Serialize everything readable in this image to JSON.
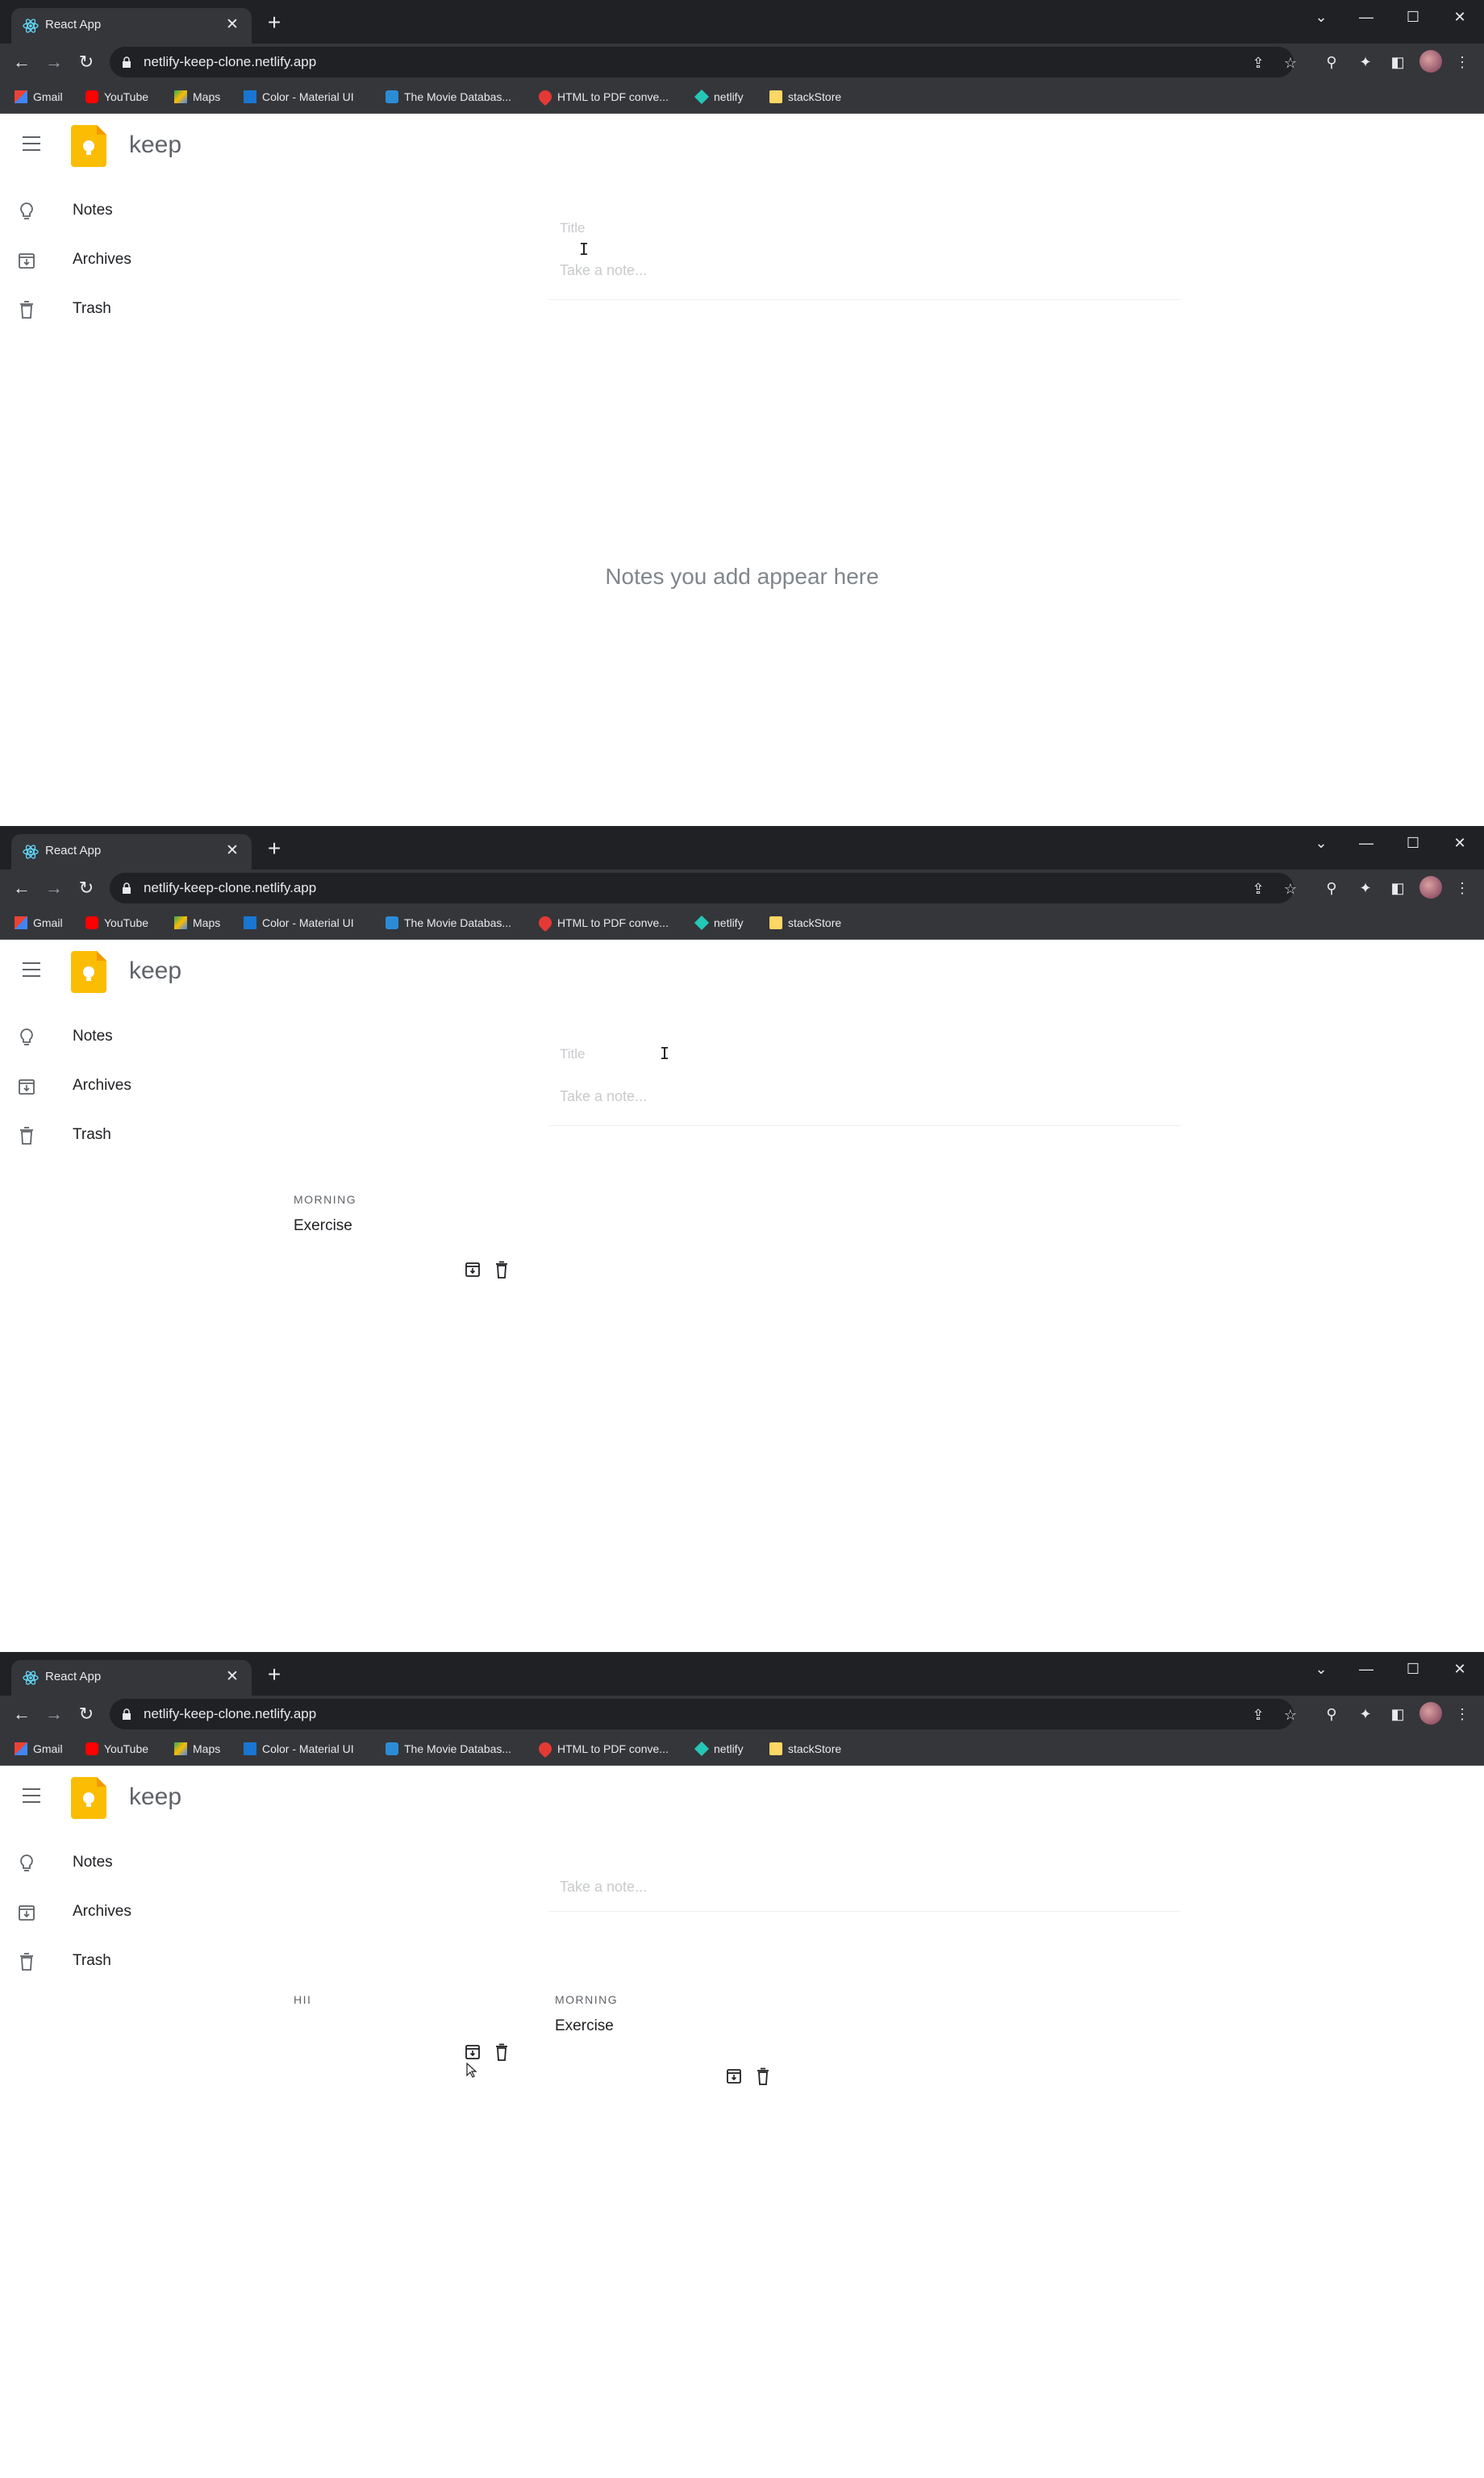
{
  "browser": {
    "tab_title": "React App",
    "url": "netlify-keep-clone.netlify.app",
    "bookmarks": [
      "Gmail",
      "YouTube",
      "Maps",
      "Color - Material UI",
      "The Movie Databas...",
      "HTML to PDF conve...",
      "netlify",
      "stackStore"
    ],
    "colors": {
      "tab_strip": "#202124",
      "toolbar": "#35363a",
      "text": "#e8eaed"
    }
  },
  "app": {
    "brand": "keep",
    "nav": [
      "Notes",
      "Archives",
      "Trash"
    ],
    "composer": {
      "title_placeholder": "Title",
      "note_placeholder": "Take a note..."
    },
    "empty_message": "Notes you add appear here",
    "colors": {
      "logo": "#fbbc04",
      "muted": "#5f6368",
      "placeholder": "#c8cacc"
    }
  },
  "frames": [
    {
      "notes": []
    },
    {
      "notes": [
        {
          "title": "MORNING",
          "body": "Exercise"
        }
      ]
    },
    {
      "notes": [
        {
          "title": "HII",
          "body": ""
        },
        {
          "title": "MORNING",
          "body": "Exercise"
        }
      ]
    }
  ]
}
